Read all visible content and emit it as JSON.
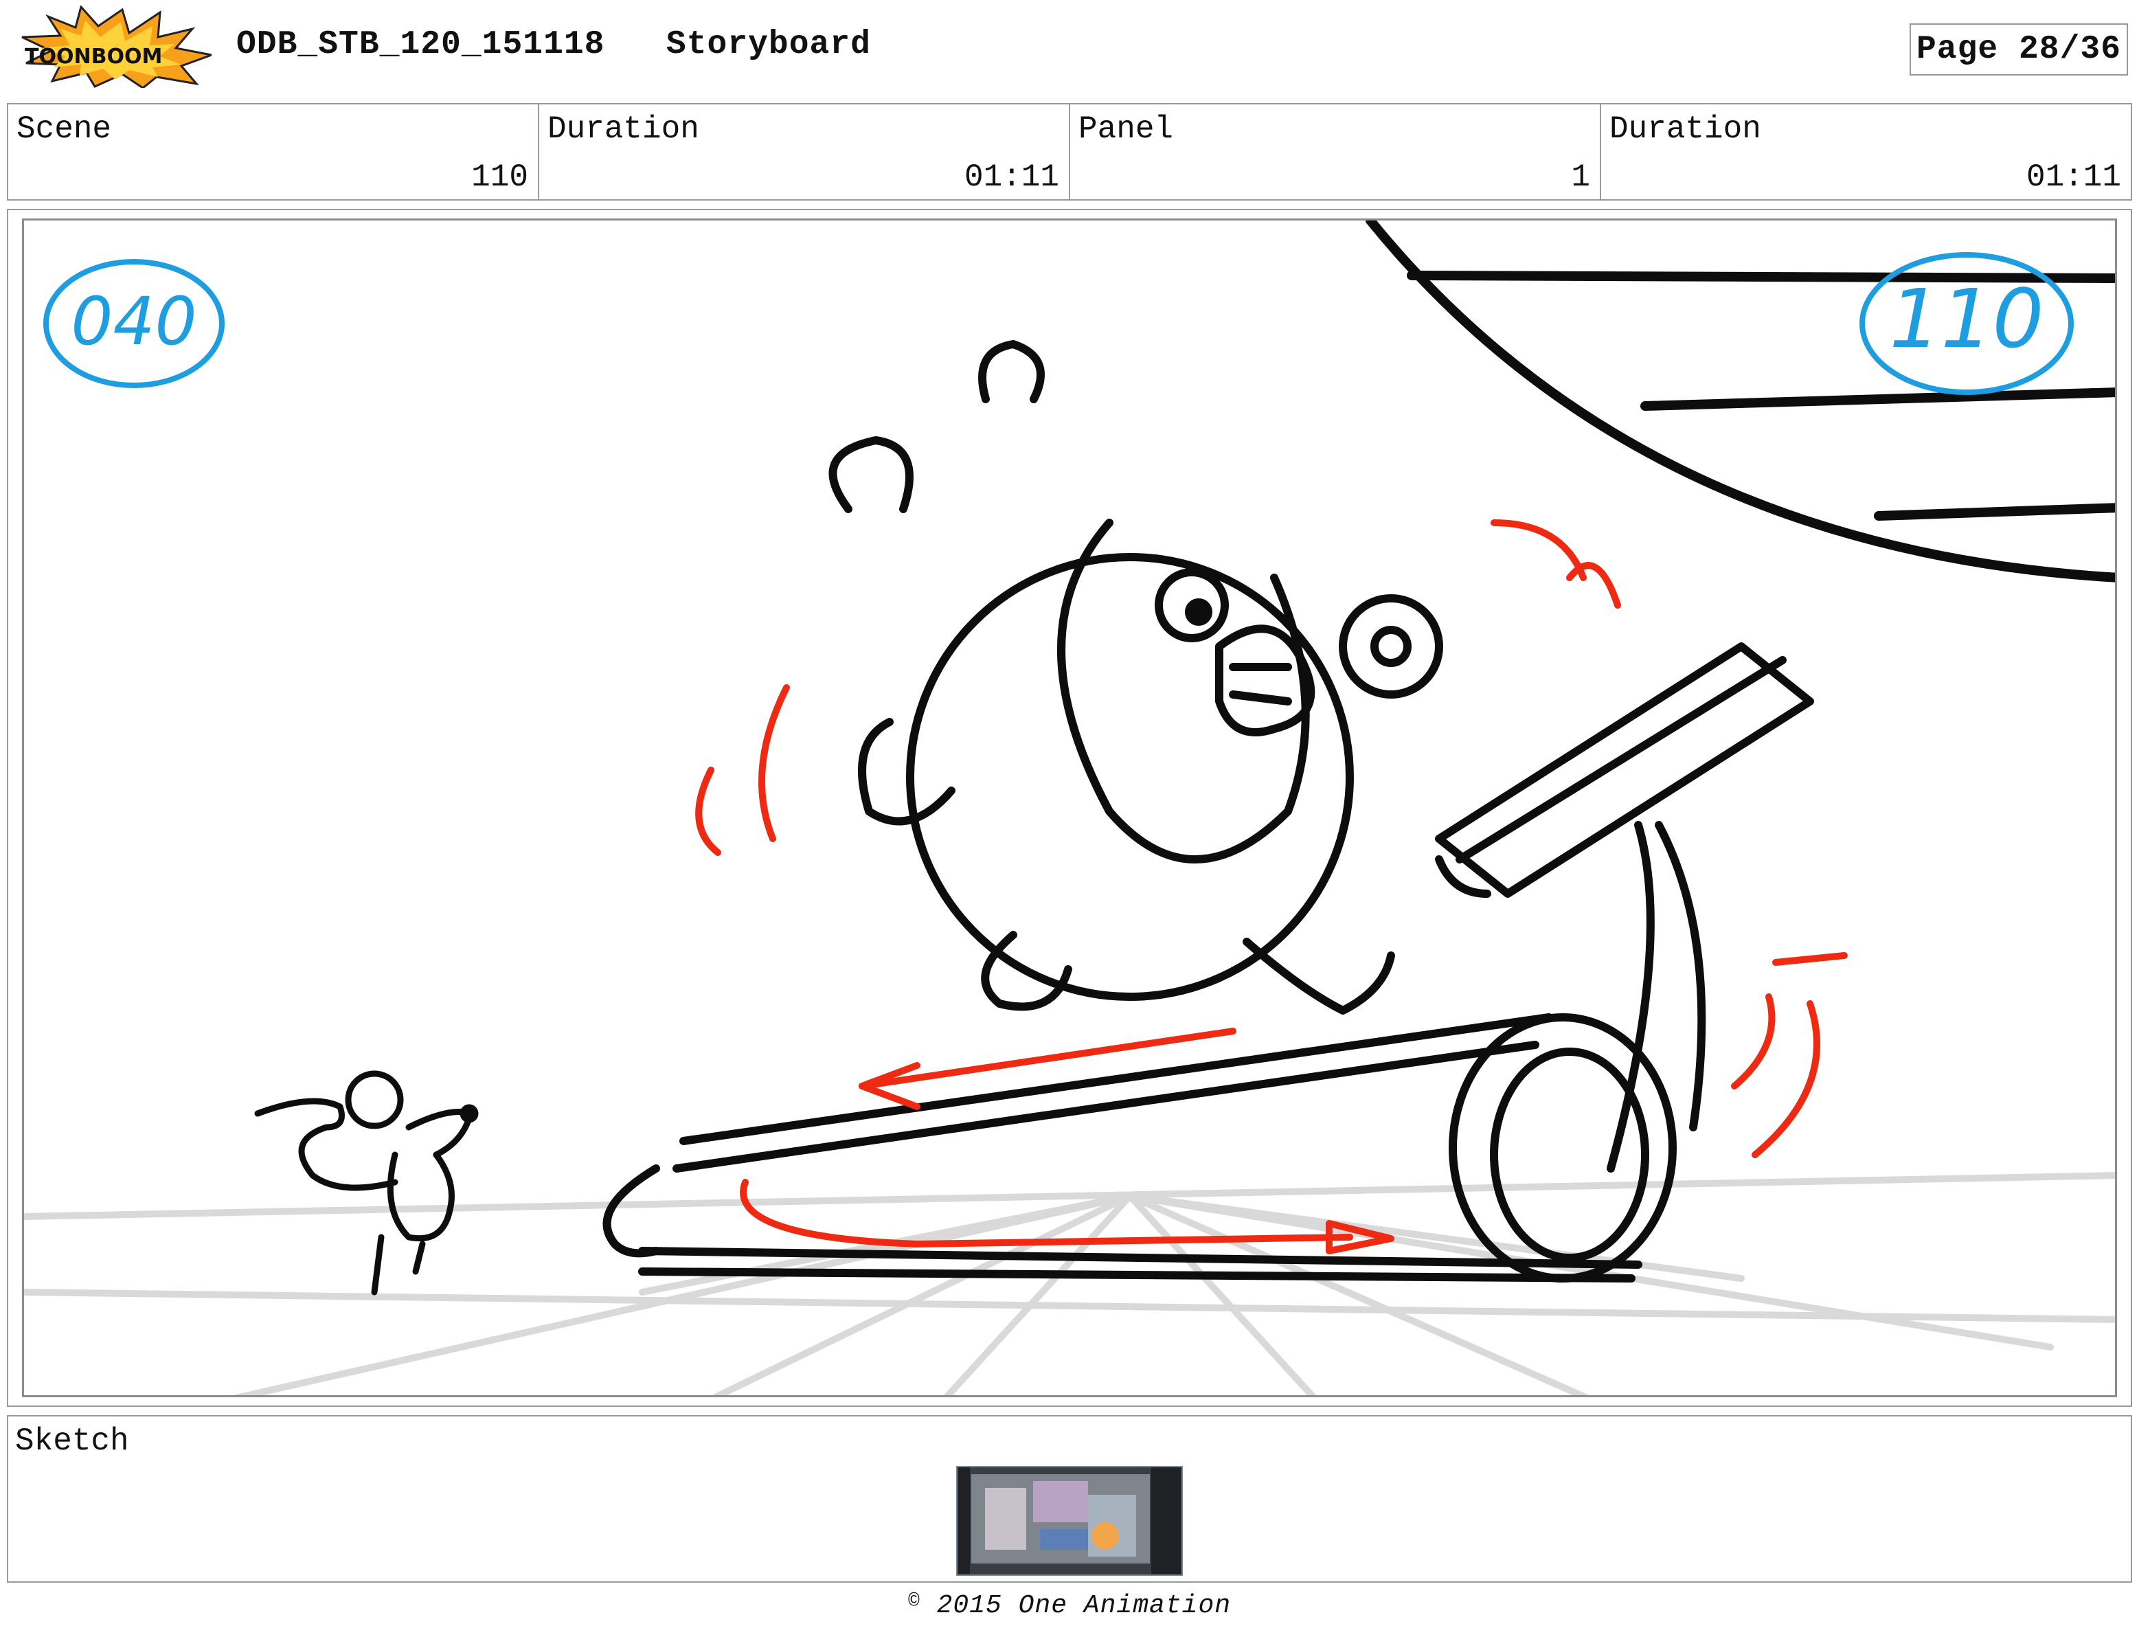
{
  "header": {
    "logo_text": "TOONBOOM",
    "project_code": "ODB_STB_120_151118",
    "doc_type": "Storyboard",
    "page": "Page 28/36"
  },
  "info": {
    "scene_label": "Scene",
    "scene_value": "110",
    "scene_duration_label": "Duration",
    "scene_duration_value": "01:11",
    "panel_label": "Panel",
    "panel_value": "1",
    "panel_duration_label": "Duration",
    "panel_duration_value": "01:11"
  },
  "panel": {
    "left_circle_number": "040",
    "right_circle_number": "110",
    "annotation_color": "#1e9de0",
    "action_color": "#ee2a12",
    "line_color": "#0d0d0d"
  },
  "sketch": {
    "label": "Sketch"
  },
  "footer": {
    "copyright": "2015 One Animation"
  }
}
